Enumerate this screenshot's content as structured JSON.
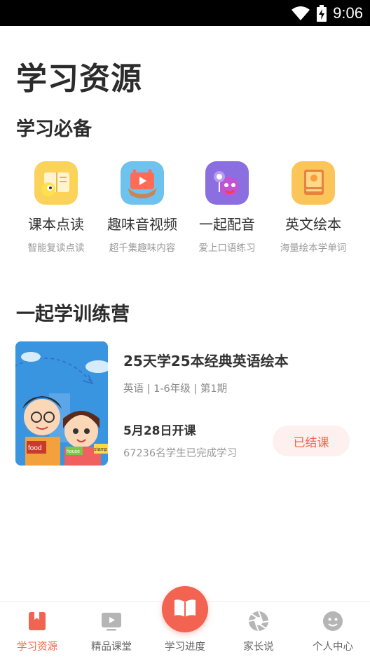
{
  "status_bar": {
    "time": "9:06"
  },
  "page_title": "学习资源",
  "sections": {
    "essentials": "学习必备",
    "camp": "一起学训练营"
  },
  "features": [
    {
      "label": "课本点读",
      "sub": "智能复读点读",
      "icon": "textbook-reading-icon",
      "color": "#fbd35a"
    },
    {
      "label": "趣味音视频",
      "sub": "超千集趣味内容",
      "icon": "video-play-icon",
      "color": "#6ec3ee"
    },
    {
      "label": "一起配音",
      "sub": "爱上口语练习",
      "icon": "dubbing-microphone-icon",
      "color": "#8b6fe0"
    },
    {
      "label": "英文绘本",
      "sub": "海量绘本学单词",
      "icon": "picture-book-icon",
      "color": "#fcc55a"
    }
  ],
  "course": {
    "title": "25天学25本经典英语绘本",
    "meta": "英语 | 1-6年级 | 第1期",
    "date": "5月28日开课",
    "count": "67236名学生已完成学习",
    "status": "已结课",
    "cover_texts": [
      "food",
      "house",
      "stamp"
    ]
  },
  "nav": {
    "items": [
      {
        "label": "学习资源",
        "icon": "bookmark-book-icon"
      },
      {
        "label": "精品课堂",
        "icon": "video-screen-icon"
      },
      {
        "label": "学习进度",
        "icon": "open-book-icon"
      },
      {
        "label": "家长说",
        "icon": "aperture-icon"
      },
      {
        "label": "个人中心",
        "icon": "smiley-face-icon"
      }
    ]
  },
  "colors": {
    "accent": "#f0674f",
    "title": "#2b2b2b",
    "muted": "#999999"
  }
}
